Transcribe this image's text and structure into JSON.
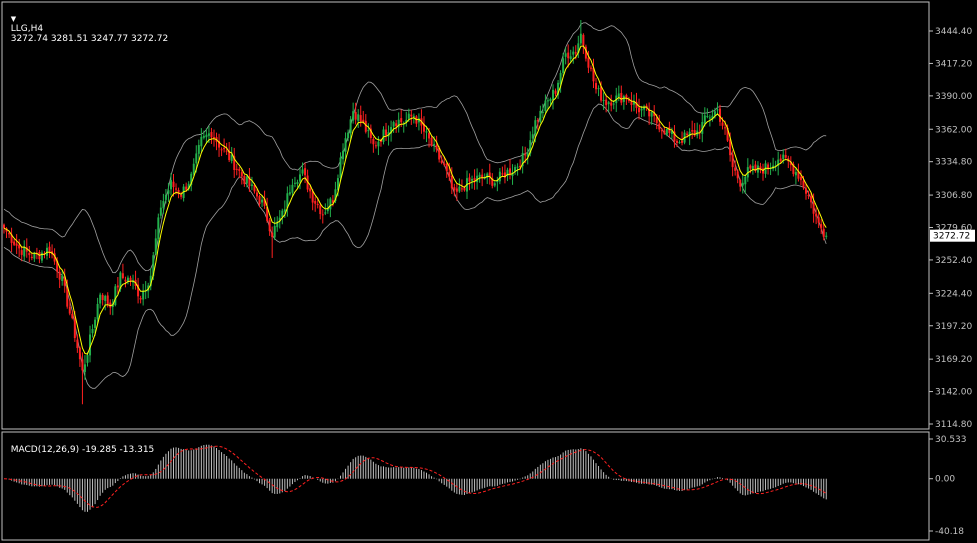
{
  "header": {
    "symbol": "LLG,H4",
    "ohlc": "3272.74 3281.51 3247.77 3272.72",
    "macd_title": "MACD(12,26,9) -19.285 -13.315"
  },
  "colors": {
    "background": "#000000",
    "axis": "#c0c0c0",
    "bull": "#22b14c",
    "bear": "#ff2020",
    "bands": "#a0a0a0",
    "ma": "#ffff00",
    "macd_hist": "#c0c0c0",
    "signal": "#ff2020",
    "price_tag_bg": "#ffffff"
  },
  "chart_data": [
    {
      "type": "candlestick",
      "title": "LLG,H4",
      "current_price": 3272.72,
      "current_price_label": "3272.72",
      "y_ticks": [
        "3444.40",
        "3417.20",
        "3390.00",
        "3362.00",
        "3334.80",
        "3306.80",
        "3279.60",
        "3252.40",
        "3224.40",
        "3197.20",
        "3169.20",
        "3142.00",
        "3114.80"
      ],
      "ylim": [
        3114.8,
        3458
      ],
      "indicators": [
        "Bollinger Bands",
        "Moving Average"
      ],
      "anchors": [
        [
          0,
          3279
        ],
        [
          6,
          3262
        ],
        [
          12,
          3255
        ],
        [
          18,
          3262
        ],
        [
          23,
          3235
        ],
        [
          28,
          3190
        ],
        [
          31,
          3158
        ],
        [
          34,
          3185
        ],
        [
          38,
          3225
        ],
        [
          42,
          3214
        ],
        [
          46,
          3238
        ],
        [
          50,
          3236
        ],
        [
          54,
          3222
        ],
        [
          58,
          3240
        ],
        [
          62,
          3298
        ],
        [
          66,
          3316
        ],
        [
          70,
          3308
        ],
        [
          74,
          3322
        ],
        [
          78,
          3352
        ],
        [
          82,
          3360
        ],
        [
          86,
          3346
        ],
        [
          90,
          3336
        ],
        [
          94,
          3323
        ],
        [
          98,
          3312
        ],
        [
          102,
          3300
        ],
        [
          106,
          3275
        ],
        [
          110,
          3290
        ],
        [
          114,
          3320
        ],
        [
          118,
          3325
        ],
        [
          122,
          3305
        ],
        [
          126,
          3292
        ],
        [
          130,
          3304
        ],
        [
          134,
          3348
        ],
        [
          138,
          3378
        ],
        [
          142,
          3366
        ],
        [
          146,
          3348
        ],
        [
          150,
          3358
        ],
        [
          154,
          3370
        ],
        [
          158,
          3368
        ],
        [
          162,
          3374
        ],
        [
          166,
          3360
        ],
        [
          170,
          3345
        ],
        [
          174,
          3330
        ],
        [
          178,
          3306
        ],
        [
          182,
          3315
        ],
        [
          186,
          3320
        ],
        [
          190,
          3322
        ],
        [
          194,
          3318
        ],
        [
          198,
          3325
        ],
        [
          202,
          3330
        ],
        [
          206,
          3340
        ],
        [
          210,
          3368
        ],
        [
          214,
          3382
        ],
        [
          218,
          3395
        ],
        [
          222,
          3425
        ],
        [
          226,
          3428
        ],
        [
          228,
          3442
        ],
        [
          231,
          3418
        ],
        [
          234,
          3395
        ],
        [
          238,
          3385
        ],
        [
          242,
          3388
        ],
        [
          246,
          3390
        ],
        [
          250,
          3380
        ],
        [
          254,
          3376
        ],
        [
          258,
          3368
        ],
        [
          262,
          3360
        ],
        [
          266,
          3352
        ],
        [
          270,
          3356
        ],
        [
          274,
          3360
        ],
        [
          278,
          3372
        ],
        [
          282,
          3378
        ],
        [
          285,
          3360
        ],
        [
          288,
          3330
        ],
        [
          291,
          3318
        ],
        [
          294,
          3326
        ],
        [
          298,
          3328
        ],
        [
          302,
          3330
        ],
        [
          306,
          3338
        ],
        [
          310,
          3334
        ],
        [
          314,
          3324
        ],
        [
          318,
          3306
        ],
        [
          322,
          3282
        ],
        [
          325,
          3272.72
        ]
      ]
    },
    {
      "type": "macd",
      "title": "MACD(12,26,9)",
      "params": [
        12,
        26,
        9
      ],
      "main_value": -19.285,
      "signal_value": -13.315,
      "y_ticks": [
        "30.533",
        "0.00",
        "-40.18"
      ],
      "ylim": [
        -40.18,
        30.533
      ]
    }
  ]
}
